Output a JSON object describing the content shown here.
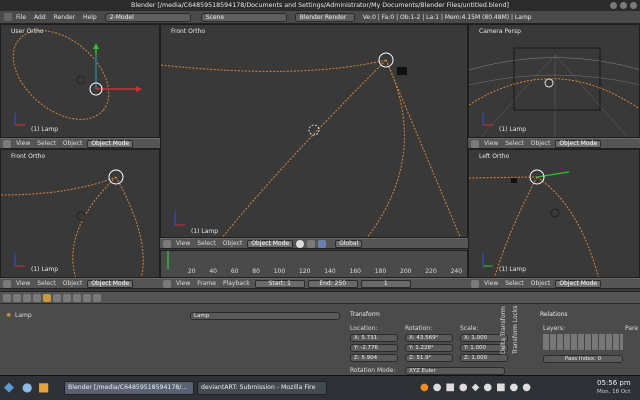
{
  "window": {
    "title": "Blender [/media/C64859518594178/Documents and Settings/Administrator/My Documents/Blender Files/untitled.blend]"
  },
  "infobar": {
    "menus": [
      "File",
      "Add",
      "Render",
      "Help"
    ],
    "screen": "2-Model",
    "scene": "Scene",
    "engine": "Blender Render",
    "stats": "Ve:0 | Fa:0 | Ob:1-2 | La:1 | Mem:4.15M (80.48M) | Lamp"
  },
  "viewports": {
    "tl": {
      "label": "User Ortho",
      "object": "(1) Lamp"
    },
    "tc": {
      "label": "Front Ortho",
      "object": "(1) Lamp"
    },
    "tr": {
      "label": "Camera Persp",
      "object": "(1) Lamp"
    },
    "bl": {
      "label": "Front Ortho",
      "object": "(1) Lamp"
    },
    "br": {
      "label": "Left Ortho",
      "object": "(1) Lamp"
    }
  },
  "header": {
    "view": "View",
    "select": "Select",
    "object": "Object",
    "mode": "Object Mode",
    "orientation": "Global"
  },
  "timeline": {
    "ticks": [
      "20",
      "40",
      "60",
      "80",
      "100",
      "120",
      "140",
      "160",
      "180",
      "200",
      "220",
      "240"
    ],
    "menus": [
      "View",
      "Frame",
      "Playback"
    ],
    "start": "Start: 1",
    "end": "End: 250",
    "current": "1"
  },
  "properties": {
    "outliner_item": "Lamp",
    "object_name": "Lamp",
    "panel": "Transform",
    "location_label": "Location:",
    "rotation_label": "Rotation:",
    "scale_label": "Scale:",
    "location": [
      "X: 5.731",
      "Y: -2.776",
      "Z: 5.904"
    ],
    "rotation": [
      "X: 43.569°",
      "Y: 1.228°",
      "Z: 51.9°"
    ],
    "scale": [
      "X: 1.000",
      "Y: 1.000",
      "Z: 1.000"
    ],
    "rotation_mode_label": "Rotation Mode:",
    "rotation_mode": "XYZ Euler",
    "delta": "Delta Transform",
    "locks": "Transform Locks",
    "relations": "Relations",
    "layers": "Layers:",
    "parent": "Pare",
    "pass_index": "Pass Index: 0"
  },
  "taskbar": {
    "task1": "Blender [/media/C64859518594178/...",
    "task2": "deviantART: Submission - Mozilla Fire",
    "time": "05:56 pm",
    "date": "Mon, 18 Oct"
  },
  "colors": {
    "axis_x": "#d03030",
    "axis_y": "#30c030",
    "axis_z": "#3050e0",
    "curve": "#d4883a"
  }
}
